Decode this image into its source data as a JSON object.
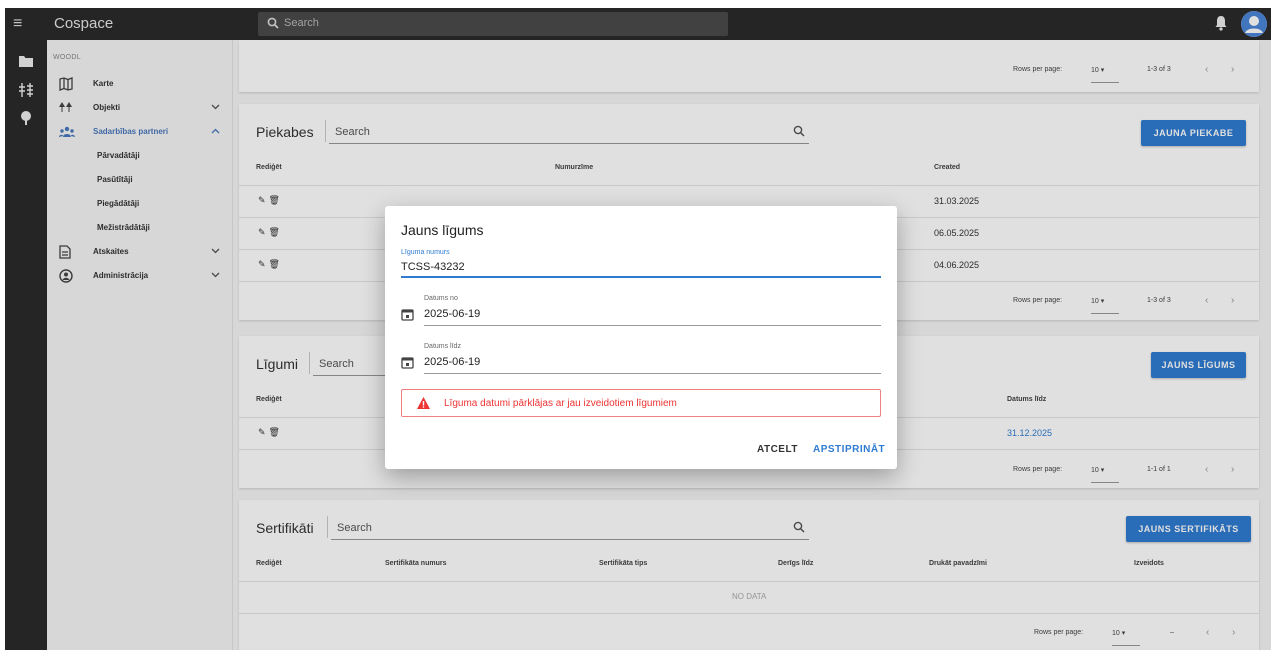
{
  "app": {
    "title": "Cospace",
    "search_placeholder": "Search"
  },
  "colors": {
    "accent": "#2f7bd1",
    "topbar": "#2b2b2b",
    "error": "#e33333"
  },
  "sidebar": {
    "section": "WOODL",
    "items": [
      {
        "label": "Karte",
        "icon": "map-icon"
      },
      {
        "label": "Objekti",
        "icon": "objects-icon"
      },
      {
        "label": "Sadarbības partneri",
        "icon": "partners-icon"
      },
      {
        "label": "Pārvadātāji"
      },
      {
        "label": "Pasūtītāji"
      },
      {
        "label": "Piegādātāji"
      },
      {
        "label": "Mežistrādātāji"
      },
      {
        "label": "Atskaites",
        "icon": "report-icon"
      },
      {
        "label": "Administrācija",
        "icon": "admin-icon"
      }
    ]
  },
  "top_card": {
    "pager": {
      "rows_per_page": "Rows per page:",
      "rows": "10",
      "range": "1-3 of 3"
    }
  },
  "piekabes": {
    "title": "Piekabes",
    "search": "Search",
    "add_button": "JAUNA PIEKABE",
    "columns": [
      "Rediģēt",
      "Numurzīme",
      "Created"
    ],
    "rows": [
      {
        "created": "31.03.2025"
      },
      {
        "created": "06.05.2025"
      },
      {
        "created": "04.06.2025"
      }
    ],
    "pager": {
      "rows_per_page": "Rows per page:",
      "rows": "10",
      "range": "1-3 of 3"
    }
  },
  "ligumi": {
    "title": "Līgumi",
    "search": "Search",
    "add_button": "JAUNS LĪGUMS",
    "columns": [
      "Rediģēt",
      "Datums līdz"
    ],
    "rows": [
      {
        "datums_lidz": "31.12.2025"
      }
    ],
    "pager": {
      "rows_per_page": "Rows per page:",
      "rows": "10",
      "range": "1-1 of 1"
    }
  },
  "sertifikati": {
    "title": "Sertifikāti",
    "search": "Search",
    "add_button": "JAUNS SERTIFIKĀTS",
    "columns": [
      "Rediģēt",
      "Sertifikāta numurs",
      "Sertifikāta tips",
      "Derīgs līdz",
      "Drukāt pavadzīmi",
      "Izveidots"
    ],
    "empty": "NO DATA",
    "pager": {
      "rows_per_page": "Rows per page:",
      "rows": "10",
      "range": "–"
    }
  },
  "dialog": {
    "title": "Jauns līgums",
    "contract_number_label": "Līguma numurs",
    "contract_number_value": "TCSS-43232",
    "date_from_label": "Datums no",
    "date_from_value": "2025-06-19",
    "date_to_label": "Datums līdz",
    "date_to_value": "2025-06-19",
    "error": "Līguma datumi pārklājas ar jau izveidotiem līgumiem",
    "cancel": "ATCELT",
    "confirm": "APSTIPRINĀT"
  }
}
